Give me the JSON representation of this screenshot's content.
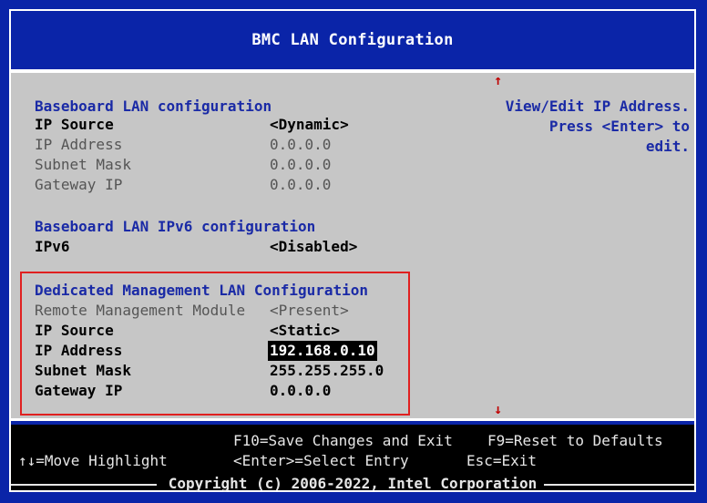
{
  "title": "BMC LAN Configuration",
  "help": {
    "line1": "View/Edit IP Address.",
    "line2": "Press <Enter> to edit."
  },
  "scroll": {
    "up_icon": "up-arrow-icon",
    "down_icon": "down-arrow-icon"
  },
  "baseboard": {
    "heading": "Baseboard LAN configuration",
    "ip_source": {
      "label": "IP Source",
      "value": "<Dynamic>"
    },
    "ip_address": {
      "label": "IP Address",
      "value": "0.0.0.0"
    },
    "subnet_mask": {
      "label": "Subnet Mask",
      "value": "0.0.0.0"
    },
    "gateway_ip": {
      "label": "Gateway IP",
      "value": "0.0.0.0"
    }
  },
  "ipv6": {
    "heading": "Baseboard LAN IPv6 configuration",
    "ipv6": {
      "label": "IPv6",
      "value": "<Disabled>"
    }
  },
  "dedicated": {
    "heading": "Dedicated Management LAN Configuration",
    "rmm": {
      "label": "Remote Management Module",
      "value": "<Present>"
    },
    "ip_source": {
      "label": "IP Source",
      "value": "<Static>"
    },
    "ip_address": {
      "label": "IP Address",
      "value": "192.168.0.10"
    },
    "subnet_mask": {
      "label": "Subnet Mask",
      "value": "255.255.255.0"
    },
    "gateway_ip": {
      "label": "Gateway IP",
      "value": "0.0.0.0"
    }
  },
  "footer": {
    "save_exit": "F10=Save Changes and Exit",
    "reset_defaults": "F9=Reset to Defaults",
    "move_highlight": "↑↓=Move Highlight",
    "select_entry": "<Enter>=Select Entry",
    "esc_exit": "Esc=Exit",
    "copyright": "Copyright (c) 2006-2022, Intel Corporation"
  },
  "colors": {
    "frame_blue": "#0a24a8",
    "panel_gray": "#c6c6c6",
    "heading_blue": "#1a2aa6",
    "highlight_box": "#e02020"
  }
}
